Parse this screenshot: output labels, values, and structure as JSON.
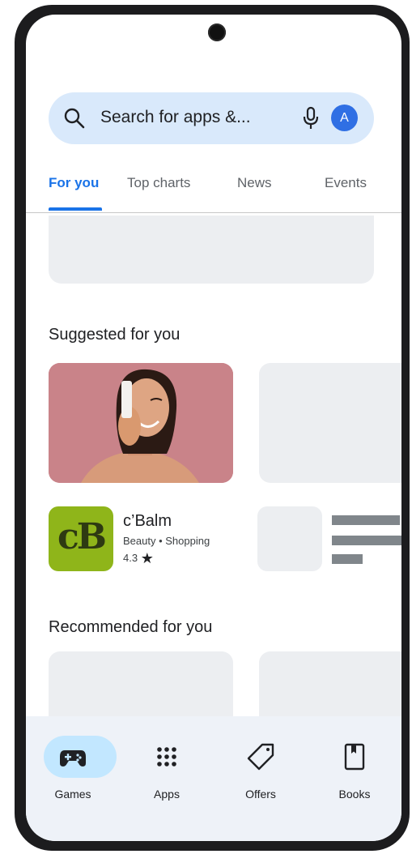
{
  "search": {
    "placeholder_text": "Search for apps &...",
    "avatar_letter": "A"
  },
  "tabs": [
    {
      "label": "For you",
      "active": true
    },
    {
      "label": "Top charts",
      "active": false
    },
    {
      "label": "News",
      "active": false
    },
    {
      "label": "Events",
      "active": false
    }
  ],
  "sections": {
    "suggested_title": "Suggested for you",
    "recommended_title": "Recommended for you"
  },
  "suggested_app": {
    "icon_text": "cB",
    "name": "c’Balm",
    "category": "Beauty • Shopping",
    "rating": "4.3"
  },
  "bottom_nav": [
    {
      "label": "Games",
      "icon": "gamepad-icon",
      "active": true
    },
    {
      "label": "Apps",
      "icon": "apps-grid-icon",
      "active": false
    },
    {
      "label": "Offers",
      "icon": "tag-icon",
      "active": false
    },
    {
      "label": "Books",
      "icon": "book-icon",
      "active": false
    }
  ],
  "colors": {
    "accent": "#1a73e8",
    "search_bg": "#d9e9fb",
    "nav_active_pill": "#c2e7ff",
    "placeholder": "#eceef1",
    "app_icon_bg": "#8fb51a"
  }
}
